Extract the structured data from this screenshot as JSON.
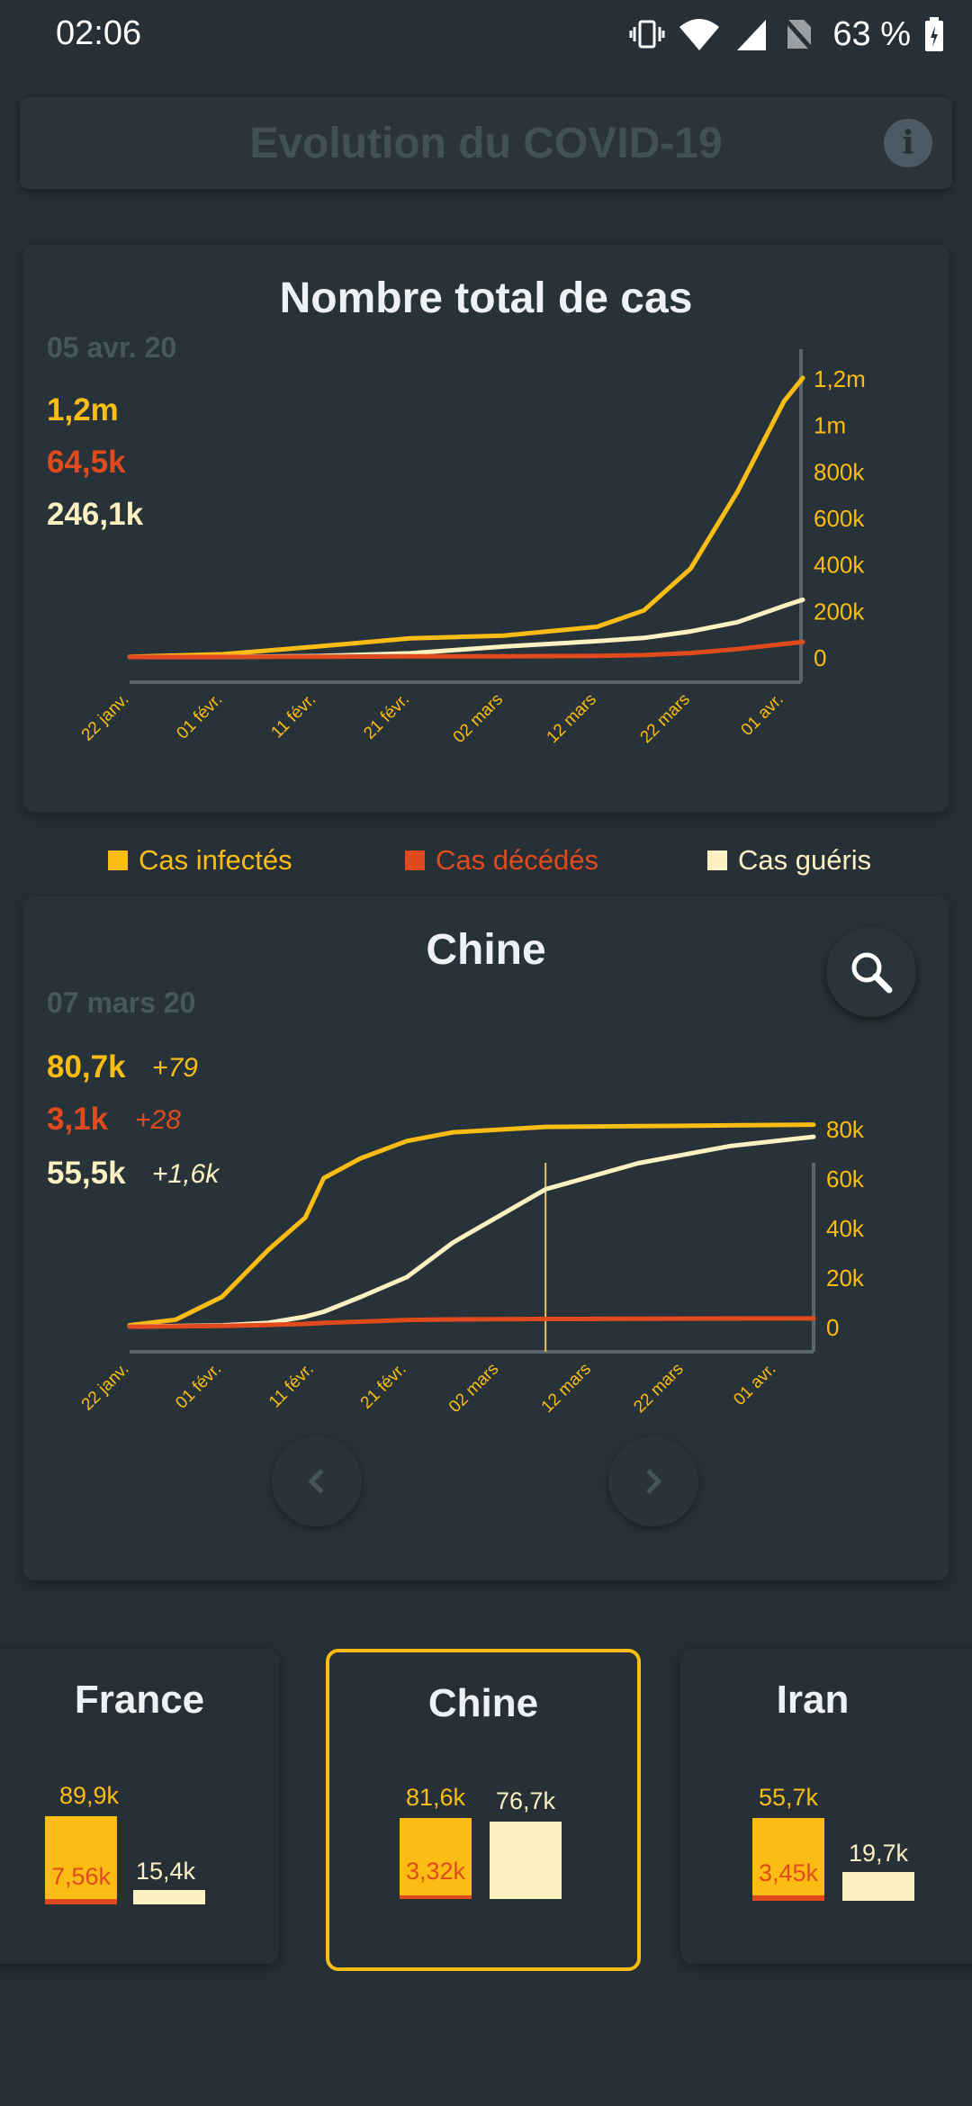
{
  "status_bar": {
    "time": "02:06",
    "battery": "63 %",
    "icons": [
      "vibrate-icon",
      "wifi-icon",
      "signal-icon",
      "no-sim-icon",
      "battery-icon"
    ]
  },
  "header": {
    "title": "Evolution du COVID-19",
    "info_icon": "info-icon"
  },
  "total": {
    "title": "Nombre total de cas",
    "date": "05 avr. 20",
    "infected": "1,2m",
    "deaths": "64,5k",
    "recovered": "246,1k",
    "chart_data": {
      "type": "line",
      "x_tick_labels": [
        "22 janv.",
        "01 févr.",
        "11 févr.",
        "21 févr.",
        "02 mars",
        "12 mars",
        "22 mars",
        "01 avr."
      ],
      "y_tick_labels": [
        "0",
        "200k",
        "400k",
        "600k",
        "800k",
        "1m",
        "1,2m"
      ],
      "ylim": [
        0,
        1200000
      ],
      "x_days": [
        0,
        10,
        20,
        30,
        40,
        50,
        55,
        60,
        65,
        70,
        72
      ],
      "series": [
        {
          "name": "Cas infectés",
          "color": "#fbbd13",
          "values": [
            600,
            12000,
            45000,
            80000,
            92000,
            130000,
            200000,
            380000,
            710000,
            1100000,
            1200000
          ]
        },
        {
          "name": "Cas décédés",
          "color": "#e04a1c",
          "values": [
            17,
            260,
            1100,
            2800,
            3200,
            5000,
            8000,
            17000,
            34000,
            56000,
            64500
          ]
        },
        {
          "name": "Cas guéris",
          "color": "#fdf1c2",
          "values": [
            30,
            300,
            4000,
            16000,
            45000,
            68000,
            82000,
            110000,
            150000,
            220000,
            246100
          ]
        }
      ]
    }
  },
  "legend": {
    "infected": "Cas infectés",
    "deaths": "Cas décédés",
    "recovered": "Cas guéris"
  },
  "country": {
    "title": "Chine",
    "date": "07 mars 20",
    "infected": "80,7k",
    "infected_delta": "+79",
    "deaths": "3,1k",
    "deaths_delta": "+28",
    "recovered": "55,5k",
    "recovered_delta": "+1,6k",
    "search_icon": "search-icon",
    "chart_data": {
      "type": "line",
      "x_tick_labels": [
        "22 janv.",
        "01 févr.",
        "11 févr.",
        "21 févr.",
        "02 mars",
        "12 mars",
        "22 mars",
        "01 avr."
      ],
      "y_tick_labels": [
        "0",
        "20k",
        "40k",
        "60k",
        "80k"
      ],
      "ylim": [
        0,
        80000
      ],
      "marker_day": 45,
      "x_days": [
        0,
        5,
        10,
        15,
        19,
        21,
        25,
        30,
        35,
        45,
        55,
        65,
        74
      ],
      "series": [
        {
          "name": "Cas infectés",
          "color": "#fbbd13",
          "values": [
            550,
            2800,
            12000,
            31000,
            44000,
            60000,
            68000,
            75000,
            78500,
            80700,
            81000,
            81300,
            81600
          ]
        },
        {
          "name": "Cas décédés",
          "color": "#e04a1c",
          "values": [
            17,
            80,
            260,
            700,
            1100,
            1500,
            2000,
            2700,
            2900,
            3100,
            3180,
            3270,
            3320
          ]
        },
        {
          "name": "Cas guéris",
          "color": "#fdf1c2",
          "values": [
            30,
            200,
            500,
            1500,
            4000,
            6000,
            12000,
            20000,
            34000,
            55500,
            66000,
            73000,
            76700
          ]
        }
      ]
    }
  },
  "carousel": [
    {
      "name": "France",
      "infected": "89,9k",
      "deaths": "7,56k",
      "recovered": "15,4k",
      "infected_value": 89900,
      "deaths_value": 7560,
      "recovered_value": 15400
    },
    {
      "name": "Chine",
      "infected": "81,6k",
      "deaths": "3,32k",
      "recovered": "76,7k",
      "infected_value": 81600,
      "deaths_value": 3320,
      "recovered_value": 76700
    },
    {
      "name": "Iran",
      "infected": "55,7k",
      "deaths": "3,45k",
      "recovered": "19,7k",
      "infected_value": 55700,
      "deaths_value": 3450,
      "recovered_value": 19700
    }
  ],
  "colors": {
    "infected": "#fbbd13",
    "deaths": "#e04a1c",
    "recovered": "#fdf1c2",
    "background": "#263036",
    "card": "#283339"
  }
}
